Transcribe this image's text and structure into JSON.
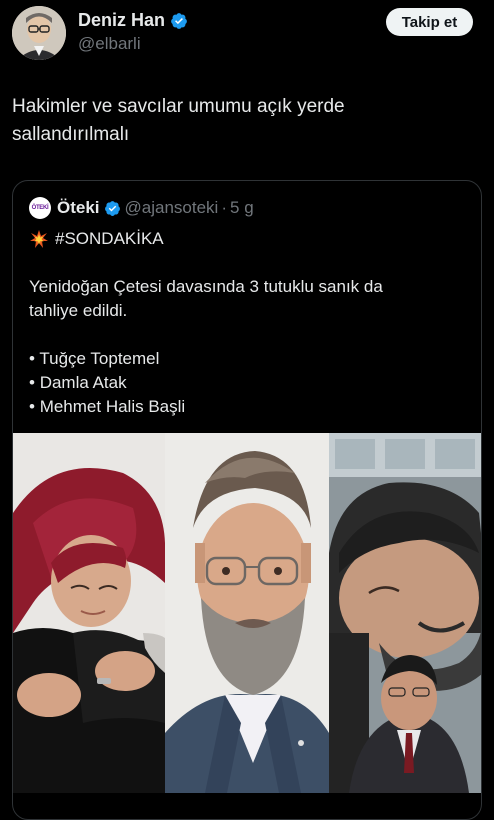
{
  "author": {
    "display_name": "Deniz Han",
    "handle": "@elbarli",
    "verified_icon": "verified-badge-icon",
    "avatar": "avatar"
  },
  "follow_button": {
    "label": "Takip et"
  },
  "tweet": {
    "text": "Hakimler ve savcılar umumu açık yerde\nsallandırılmalı"
  },
  "quoted_tweet": {
    "avatar_text": "ÖTEKİ",
    "display_name": "Öteki",
    "handle": "@ajansoteki",
    "separator": "·",
    "time": "5 g",
    "hashtag": "#SONDAKİKA",
    "hashtag_icon": "collision-icon",
    "line1": "Yenidoğan Çetesi davasında 3 tutuklu sanık da",
    "line2": "tahliye edildi.",
    "bullets": [
      "Tuğçe Toptemel",
      "Damla Atak",
      "Mehmet Halis Başli"
    ]
  },
  "colors": {
    "background": "#000000",
    "text": "#e7e9ea",
    "muted": "#71767b",
    "verified": "#1d9bf0",
    "border": "#2f3336"
  }
}
